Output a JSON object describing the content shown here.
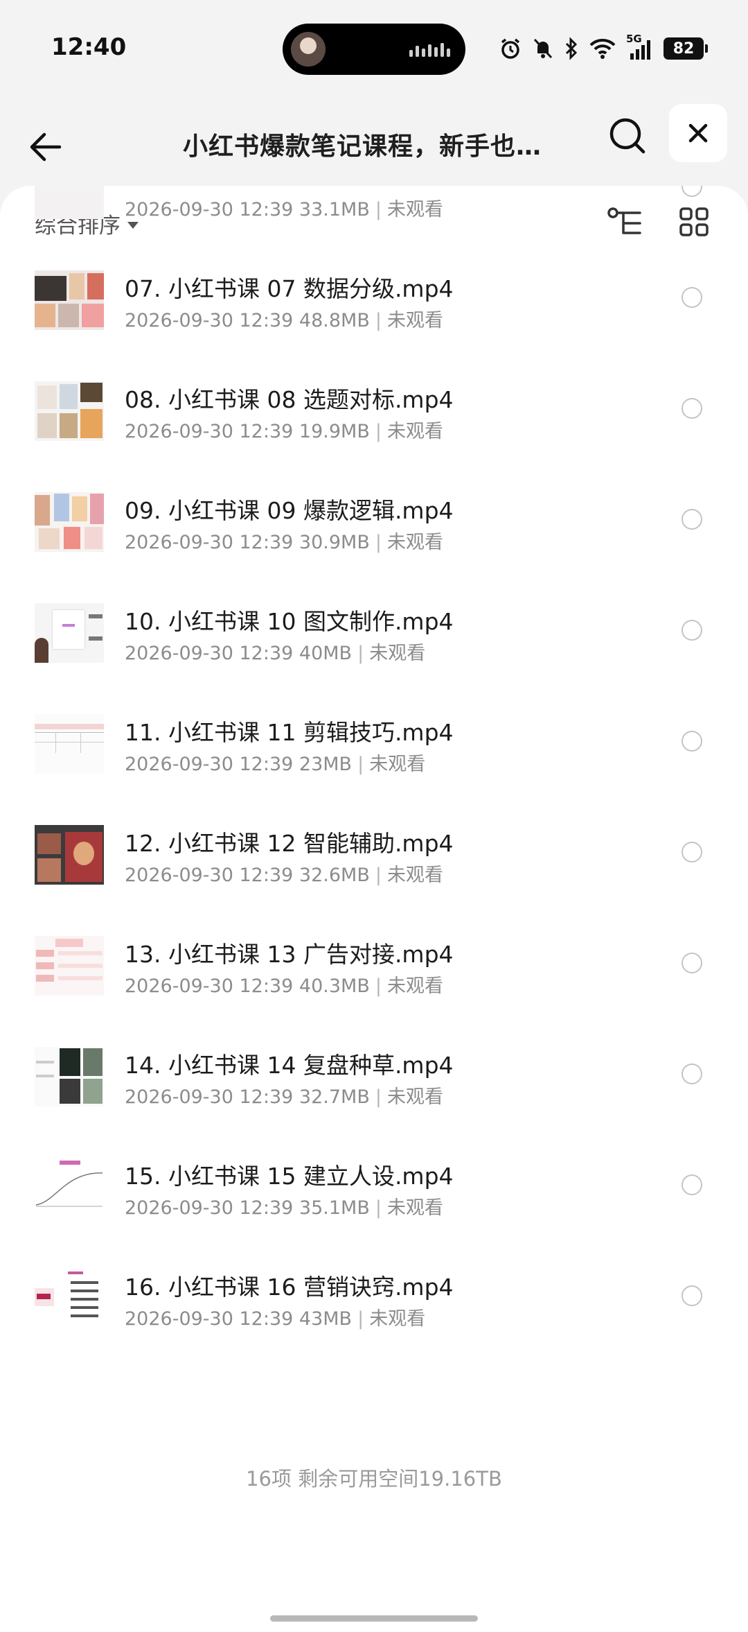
{
  "status_bar": {
    "time": "12:40",
    "network": "5G",
    "battery": "82"
  },
  "header": {
    "title": "小红书爆款笔记课程，新手也…"
  },
  "toolbar": {
    "sort_label": "综合排序"
  },
  "files": [
    {
      "name": "",
      "date": "2026-09-30 12:39",
      "size": "33.1MB",
      "status": "未观看",
      "thumb": "a"
    },
    {
      "name": "07. 小红书课 07 数据分级.mp4",
      "date": "2026-09-30 12:39",
      "size": "48.8MB",
      "status": "未观看",
      "thumb": "b"
    },
    {
      "name": "08. 小红书课 08 选题对标.mp4",
      "date": "2026-09-30 12:39",
      "size": "19.9MB",
      "status": "未观看",
      "thumb": "c"
    },
    {
      "name": "09. 小红书课 09 爆款逻辑.mp4",
      "date": "2026-09-30 12:39",
      "size": "30.9MB",
      "status": "未观看",
      "thumb": "d"
    },
    {
      "name": "10. 小红书课 10 图文制作.mp4",
      "date": "2026-09-30 12:39",
      "size": "40MB",
      "status": "未观看",
      "thumb": "e"
    },
    {
      "name": "11. 小红书课 11 剪辑技巧.mp4",
      "date": "2026-09-30 12:39",
      "size": "23MB",
      "status": "未观看",
      "thumb": "f"
    },
    {
      "name": "12. 小红书课 12 智能辅助.mp4",
      "date": "2026-09-30 12:39",
      "size": "32.6MB",
      "status": "未观看",
      "thumb": "g"
    },
    {
      "name": "13. 小红书课 13 广告对接.mp4",
      "date": "2026-09-30 12:39",
      "size": "40.3MB",
      "status": "未观看",
      "thumb": "h"
    },
    {
      "name": "14. 小红书课 14 复盘种草.mp4",
      "date": "2026-09-30 12:39",
      "size": "32.7MB",
      "status": "未观看",
      "thumb": "i"
    },
    {
      "name": "15. 小红书课 15 建立人设.mp4",
      "date": "2026-09-30 12:39",
      "size": "35.1MB",
      "status": "未观看",
      "thumb": "j"
    },
    {
      "name": "16. 小红书课 16 营销诀窍.mp4",
      "date": "2026-09-30 12:39",
      "size": "43MB",
      "status": "未观看",
      "thumb": "k"
    }
  ],
  "footer": {
    "summary": "16项 剩余可用空间19.16TB"
  }
}
